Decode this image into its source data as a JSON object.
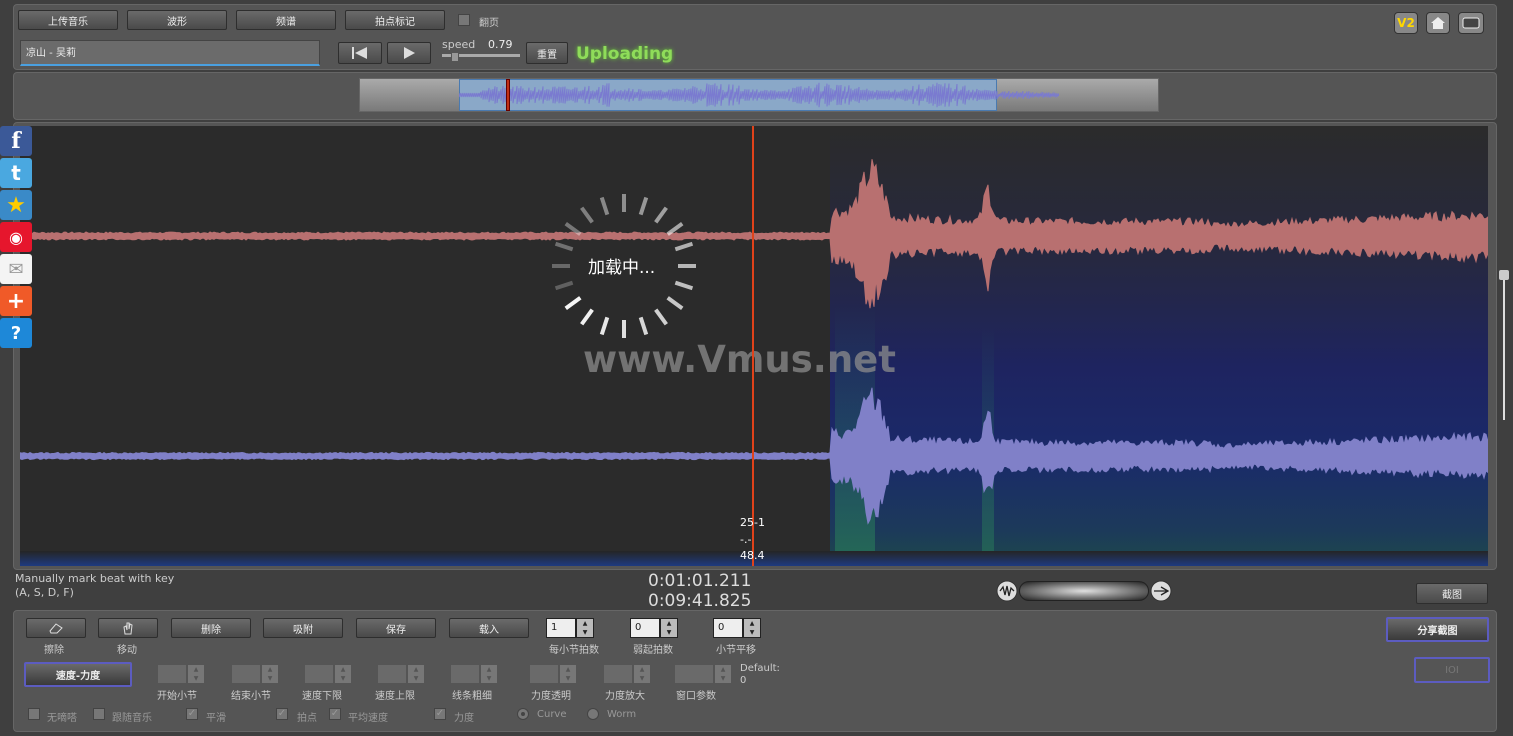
{
  "toolbar": {
    "upload_label": "上传音乐",
    "waveform_label": "波形",
    "spectrum_label": "频谱",
    "beat_mark_label": "拍点标记",
    "page_flip_label": "翻页",
    "song_title": "凉山 - 吴莉",
    "speed_label": "speed",
    "speed_value": "0.79",
    "reset_label": "重置",
    "status_text": "Uploading",
    "version_badge": "V2"
  },
  "main": {
    "loading_text": "加载中...",
    "watermark": "www.Vmus.net",
    "cursor_label_1": "25-1",
    "cursor_label_2": "-.-",
    "cursor_label_3": "48.4"
  },
  "info": {
    "hint_line1": "Manually mark beat with key",
    "hint_line2": "(A, S, D, F)",
    "time_current": "0:01:01.211",
    "time_total": "0:09:41.825",
    "screenshot_label": "截图"
  },
  "controls": {
    "erase_label": "擦除",
    "move_label": "移动",
    "delete_label": "删除",
    "snap_label": "吸附",
    "save_label": "保存",
    "load_label": "载入",
    "beats_per_bar_value": "1",
    "beats_per_bar_label": "每小节拍数",
    "weak_beats_value": "0",
    "weak_beats_label": "弱起拍数",
    "bar_shift_value": "0",
    "bar_shift_label": "小节平移",
    "share_label": "分享截图",
    "speed_force_label": "速度-力度",
    "start_bar_label": "开始小节",
    "end_bar_label": "结束小节",
    "speed_min_label": "速度下限",
    "speed_max_label": "速度上限",
    "line_width_label": "线条粗细",
    "force_transparency_label": "力度透明",
    "force_scale_label": "力度放大",
    "window_param_label": "窗口参数",
    "default_label": "Default:",
    "default_value": "0",
    "ioi_label": "IOI",
    "metronome_label": "无嘀嗒",
    "follow_music_label": "跟随音乐",
    "smooth_label": "平滑",
    "beat_point_label": "拍点",
    "avg_speed_label": "平均速度",
    "force_label": "力度",
    "curve_label": "Curve",
    "worm_label": "Worm"
  },
  "colors": {
    "status_green": "#8fdc5a",
    "cursor_red": "#e0421a",
    "wave_top": "#b87070",
    "wave_bottom": "#8080c8",
    "overview_wave": "#7a7ad0"
  }
}
